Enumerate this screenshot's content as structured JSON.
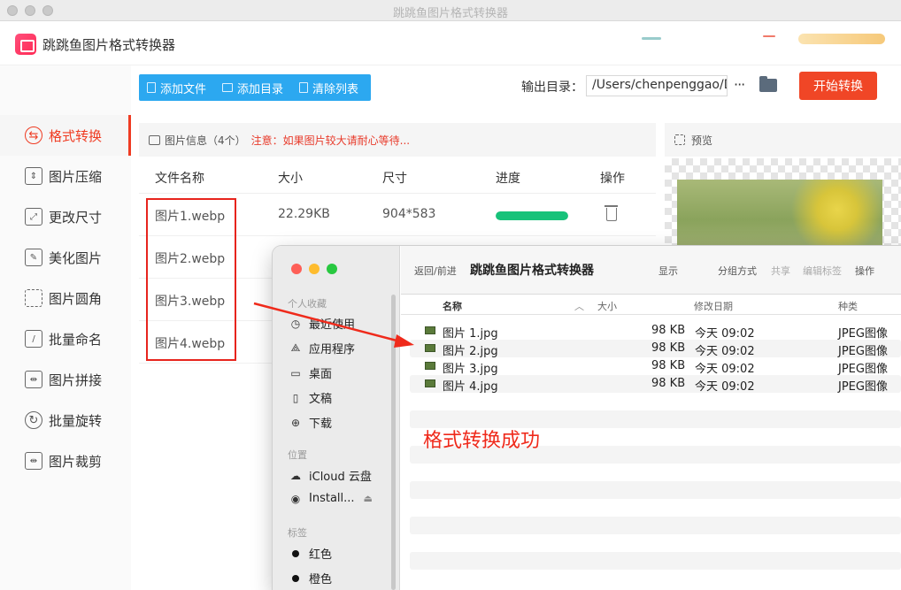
{
  "window": {
    "title": "跳跳鱼图片格式转换器"
  },
  "app": {
    "name": "跳跳鱼图片格式转换器"
  },
  "sidebar": {
    "items": [
      {
        "label": "格式转换",
        "icon": "convert-icon",
        "active": true
      },
      {
        "label": "图片压缩",
        "icon": "compress-icon"
      },
      {
        "label": "更改尺寸",
        "icon": "resize-icon"
      },
      {
        "label": "美化图片",
        "icon": "beautify-icon"
      },
      {
        "label": "图片圆角",
        "icon": "rounded-corner-icon"
      },
      {
        "label": "批量命名",
        "icon": "rename-icon"
      },
      {
        "label": "图片拼接",
        "icon": "stitch-icon"
      },
      {
        "label": "批量旋转",
        "icon": "rotate-icon"
      },
      {
        "label": "图片裁剪",
        "icon": "crop-icon"
      }
    ]
  },
  "toolbar": {
    "add_file": "添加文件",
    "add_dir": "添加目录",
    "clear_list": "清除列表"
  },
  "output": {
    "label": "输出目录：",
    "path": "/Users/chenpenggao/D",
    "more": "···",
    "start": "开始转换"
  },
  "info": {
    "title": "图片信息（4个）",
    "note": "注意：如果图片较大请耐心等待..."
  },
  "preview": {
    "title": "预览"
  },
  "table": {
    "headers": {
      "name": "文件名称",
      "size": "大小",
      "dimension": "尺寸",
      "progress": "进度",
      "action": "操作"
    },
    "rows": [
      {
        "name": "图片1.webp",
        "size": "22.29KB",
        "dimension": "904*583",
        "progress": 1.0
      },
      {
        "name": "图片2.webp",
        "size": "",
        "dimension": "",
        "progress": null
      },
      {
        "name": "图片3.webp",
        "size": "",
        "dimension": "",
        "progress": null
      },
      {
        "name": "图片4.webp",
        "size": "",
        "dimension": "",
        "progress": null
      }
    ]
  },
  "finder": {
    "nav": "返回/前进",
    "title": "跳跳鱼图片格式转换器",
    "actions": {
      "show": "显示",
      "group": "分组方式",
      "share": "共享",
      "edit_tags": "编辑标签",
      "action": "操作"
    },
    "sections": {
      "favorites": "个人收藏",
      "locations": "位置",
      "tags": "标签"
    },
    "favorites": [
      {
        "label": "最近使用",
        "icon": "clock-icon"
      },
      {
        "label": "应用程序",
        "icon": "apps-icon"
      },
      {
        "label": "桌面",
        "icon": "desktop-icon"
      },
      {
        "label": "文稿",
        "icon": "document-icon"
      },
      {
        "label": "下载",
        "icon": "download-icon"
      }
    ],
    "locations": [
      {
        "label": "iCloud 云盘",
        "icon": "cloud-icon"
      },
      {
        "label": "Install...",
        "icon": "disk-icon"
      }
    ],
    "tags": [
      {
        "label": "红色"
      },
      {
        "label": "橙色"
      }
    ],
    "columns": {
      "name": "名称",
      "size": "大小",
      "modified": "修改日期",
      "kind": "种类"
    },
    "files": [
      {
        "name": "图片 1.jpg",
        "size": "98 KB",
        "modified": "今天 09:02",
        "kind": "JPEG图像"
      },
      {
        "name": "图片 2.jpg",
        "size": "98 KB",
        "modified": "今天 09:02",
        "kind": "JPEG图像"
      },
      {
        "name": "图片 3.jpg",
        "size": "98 KB",
        "modified": "今天 09:02",
        "kind": "JPEG图像"
      },
      {
        "name": "图片 4.jpg",
        "size": "98 KB",
        "modified": "今天 09:02",
        "kind": "JPEG图像"
      }
    ]
  },
  "annotation": {
    "text": "格式转换成功",
    "color": "#ef2a1b"
  },
  "colors": {
    "accent": "#ef3b22",
    "toolbar": "#2ca8f0",
    "progress": "#17c27a"
  }
}
